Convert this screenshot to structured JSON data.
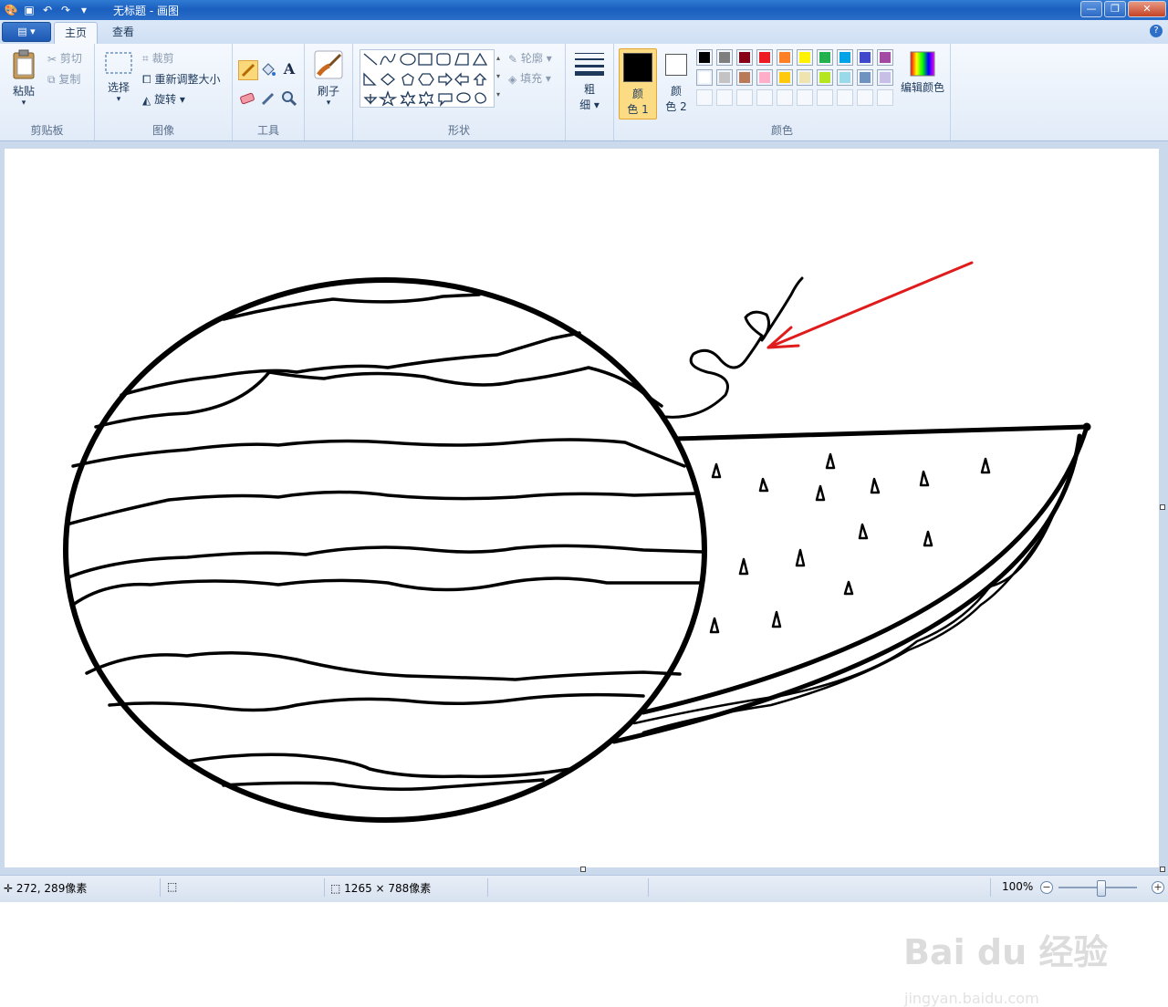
{
  "window": {
    "title": "无标题 - 画图"
  },
  "menu": {
    "app_button": "▤ ▾",
    "tabs": [
      "主页",
      "查看"
    ],
    "help": "?"
  },
  "clipboard": {
    "paste": "粘贴",
    "cut": "剪切",
    "copy": "复制",
    "label": "剪贴板"
  },
  "image": {
    "select": "选择",
    "crop": "裁剪",
    "resize": "重新调整大小",
    "rotate": "旋转",
    "label": "图像"
  },
  "tools": {
    "label": "工具"
  },
  "brushes": {
    "label": "刷子"
  },
  "shapes": {
    "outline": "轮廓",
    "fill": "填充",
    "label": "形状"
  },
  "size": {
    "label_line1": "粗",
    "label_line2": "细"
  },
  "colors": {
    "color1_line1": "颜",
    "color1_line2": "色 1",
    "color2_line1": "颜",
    "color2_line2": "色 2",
    "edit": "编辑颜色",
    "label": "颜色",
    "color1_value": "#000000",
    "color2_value": "#ffffff",
    "palette_row1": [
      "#000000",
      "#7f7f7f",
      "#880015",
      "#ed1c24",
      "#ff7f27",
      "#fff200",
      "#22b14c",
      "#00a2e8",
      "#3f48cc",
      "#a349a4"
    ],
    "palette_row2": [
      "#ffffff",
      "#c3c3c3",
      "#b97a57",
      "#ffaec9",
      "#ffc90e",
      "#efe4b0",
      "#b5e61d",
      "#99d9ea",
      "#7092be",
      "#c8bfe7"
    ]
  },
  "status": {
    "cursor_pos": "272, 289像素",
    "canvas_size": "1265 × 788像素",
    "zoom": "100%"
  },
  "watermark": {
    "brand": "Bai du 经验",
    "url": "jingyan.baidu.com"
  }
}
